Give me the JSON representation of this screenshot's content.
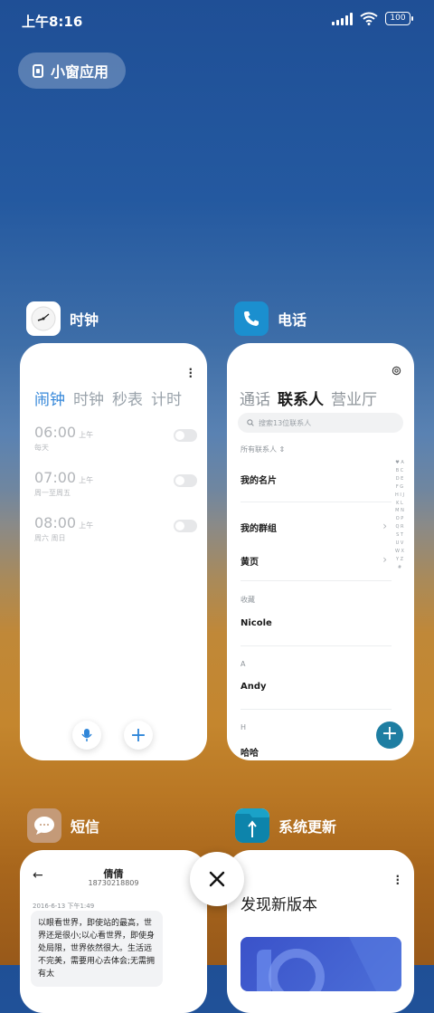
{
  "status": {
    "time": "上午8:16",
    "battery": "100"
  },
  "floating_window_button": "小窗应用",
  "apps": {
    "clock": {
      "name": "时钟",
      "tabs": [
        "闹钟",
        "时钟",
        "秒表",
        "计时"
      ],
      "alarms": [
        {
          "time": "06:00",
          "ampm": "上午",
          "repeat": "每天"
        },
        {
          "time": "07:00",
          "ampm": "上午",
          "repeat": "周一至周五"
        },
        {
          "time": "08:00",
          "ampm": "上午",
          "repeat": "周六 周日"
        }
      ]
    },
    "phone": {
      "name": "电话",
      "tabs": [
        "通话",
        "联系人",
        "营业厅"
      ],
      "search_placeholder": "搜索13位联系人",
      "all_contacts": "所有联系人",
      "my_card": "我的名片",
      "my_groups": "我的群组",
      "yellow_pages": "黄页",
      "favorites_header": "收藏",
      "favorite_contact": "Nicole",
      "section_a": "A",
      "contact_a": "Andy",
      "section_h": "H",
      "contact_h": "哈哈",
      "index_letters": "♥ A B C D E F G H I J K L M N O P Q R S T U V W X Y Z #"
    },
    "sms": {
      "name": "短信",
      "contact_name": "倩倩",
      "contact_number": "18730218809",
      "date": "2016-6-13 下午1:49",
      "message": "以眼看世界，即使站的最高，世界还是很小;以心看世界，即使身处局限，世界依然很大。生活远不完美，需要用心去体会;无需拥有太"
    },
    "update": {
      "name": "系统更新",
      "title": "发现新版本"
    }
  },
  "colors": {
    "accent_blue": "#3587d9",
    "fab_teal": "#1e7ea2"
  }
}
